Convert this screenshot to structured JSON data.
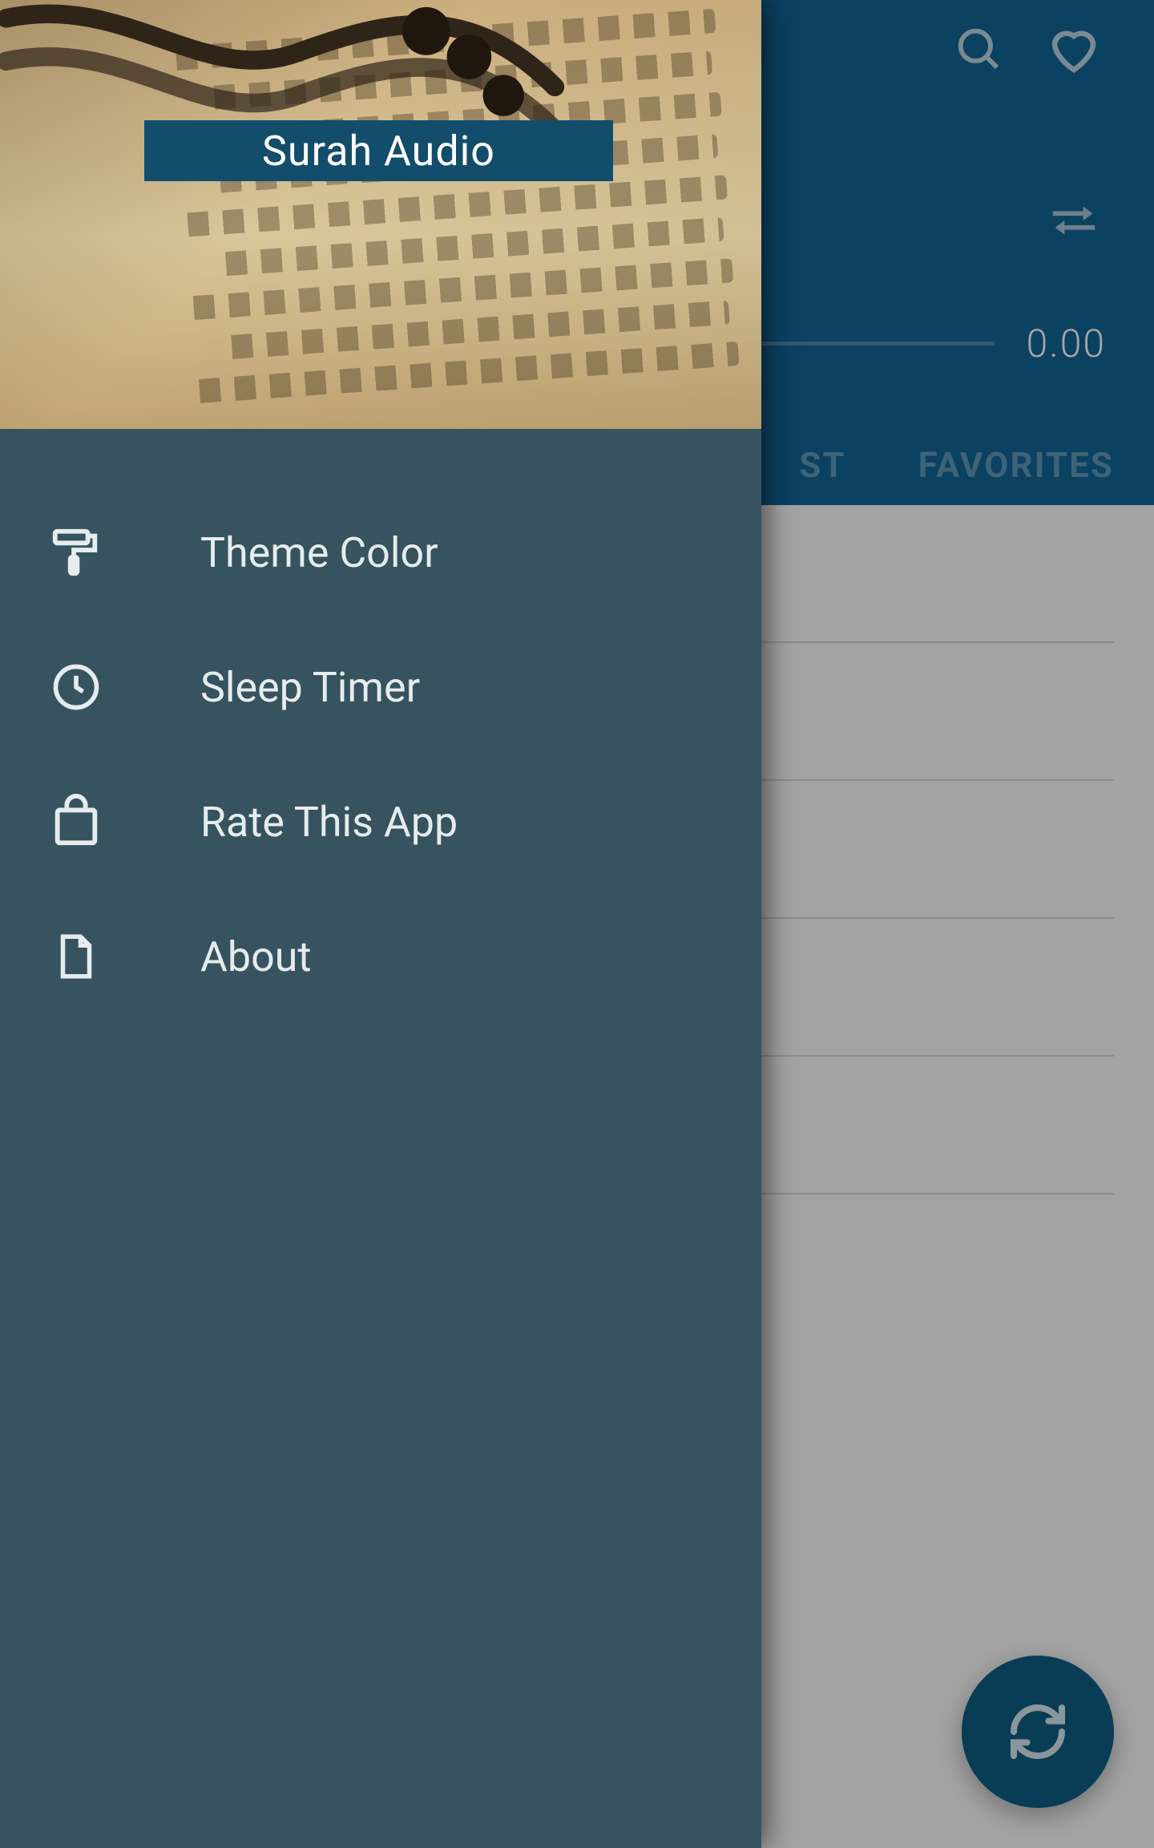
{
  "drawer": {
    "title": "Surah Audio",
    "items": [
      {
        "icon": "paint-roller-icon",
        "label": "Theme Color"
      },
      {
        "icon": "clock-icon",
        "label": "Sleep Timer"
      },
      {
        "icon": "shopping-bag-icon",
        "label": "Rate This App"
      },
      {
        "icon": "file-icon",
        "label": "About"
      }
    ]
  },
  "player": {
    "time_left": "",
    "time_right": "0.00",
    "tabs": {
      "list_suffix": "ST",
      "favorites": "FAVORITES"
    }
  },
  "colors": {
    "brand": "#116595",
    "drawer_bg": "#36535f",
    "title_bg": "#124e6c"
  }
}
